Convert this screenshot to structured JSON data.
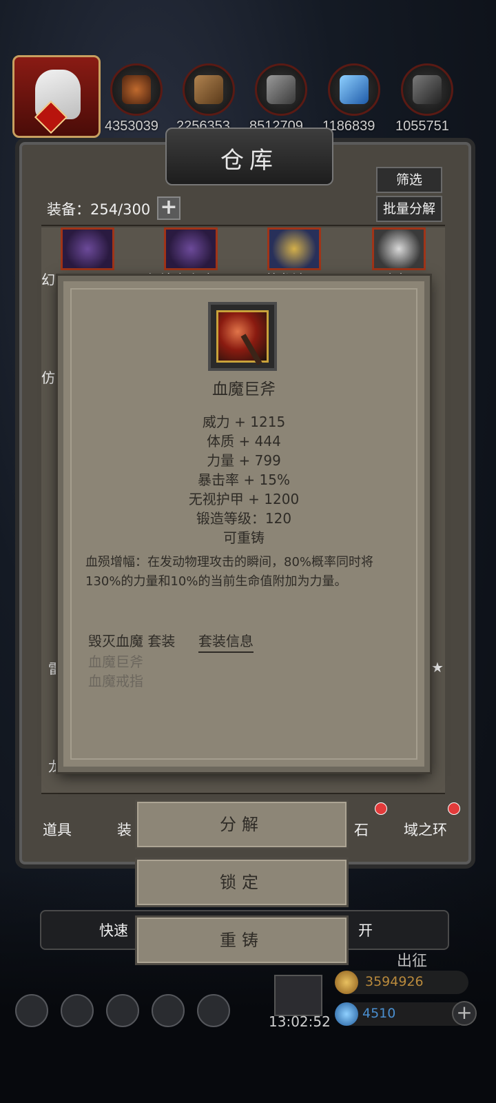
{
  "resources": [
    "4353039",
    "2256353",
    "8512709",
    "1186839",
    "1055751"
  ],
  "warehouse": {
    "title": "仓库",
    "equip_count": "装备：254/300",
    "filter_label": "筛选",
    "batch_label": "批量分解",
    "item_labels": [
      "幻",
      "幻境之主魔冠",
      "苍龙法冠",
      "不思骑士冠"
    ],
    "side_labels": [
      "仿",
      "雷",
      "龙"
    ],
    "star": "★"
  },
  "tabs": [
    "道具",
    "装",
    "石",
    "域之环"
  ],
  "tooltip": {
    "name": "血魔巨斧",
    "stats": [
      "威力 + 1215",
      "体质 + 444",
      "力量 + 799",
      "暴击率 + 15%",
      "无视护甲 + 1200",
      "锻造等级：120",
      "可重铸"
    ],
    "description": "血殒增幅：在发动物理攻击的瞬间，80%概率同时将130%的力量和10%的当前生命值附加为力量。",
    "set_name": "毁灭血魔 套装",
    "set_info_label": "套装信息",
    "set_items": [
      "血魔巨斧",
      "血魔戒指"
    ]
  },
  "actions": {
    "decompose": "分解",
    "lock": "锁定",
    "reforge": "重铸"
  },
  "bottom": {
    "quick_label": "快速",
    "leave_label": "开",
    "expedition": "出征",
    "time": "13:02:52",
    "gold": "3594926",
    "gems": "4510"
  }
}
